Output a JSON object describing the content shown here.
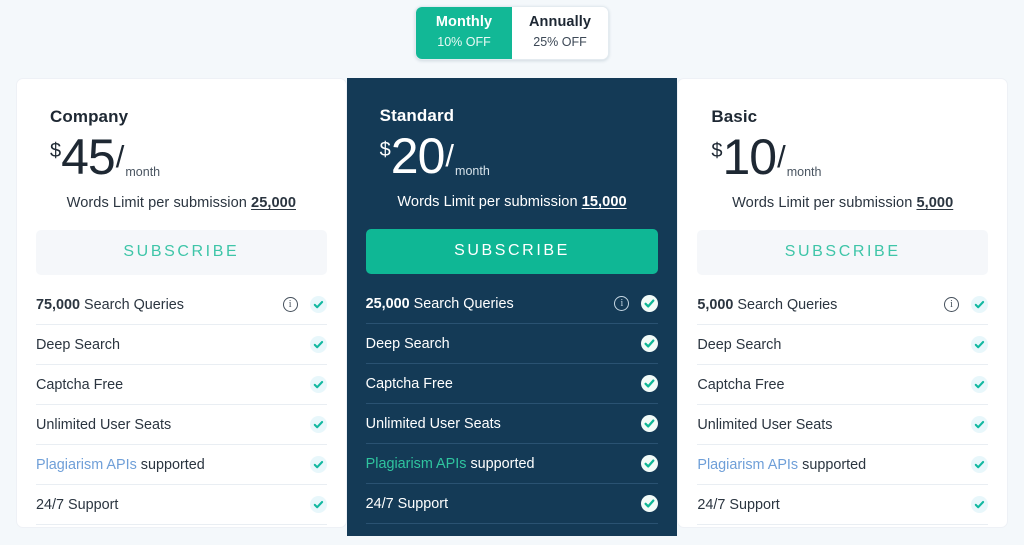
{
  "billing_toggle": {
    "options": [
      {
        "name": "Monthly",
        "discount": "10% OFF",
        "active": true
      },
      {
        "name": "Annually",
        "discount": "25% OFF",
        "active": false
      }
    ]
  },
  "colors": {
    "page_background": "#f4f8fb",
    "accent_teal": "#0fb795",
    "featured_card_background": "#143a56",
    "ghost_button_background": "#f5f7fa",
    "ghost_button_text": "#3ec5a8",
    "link_blue": "#6f9fd8",
    "link_teal": "#2fc49f"
  },
  "plans": [
    {
      "name": "Company",
      "currency": "$",
      "amount": "45",
      "slash": "/",
      "period": "month",
      "words_limit_label": "Words Limit per submission",
      "words_limit_value": "25,000",
      "subscribe_label": "SUBSCRIBE",
      "featured": false,
      "features": [
        {
          "strong": "75,000",
          "text": " Search Queries",
          "info": true,
          "info_icon": "info-icon",
          "check_icon": "check-icon",
          "link": ""
        },
        {
          "strong": "",
          "text": "Deep Search",
          "info": false,
          "info_icon": "",
          "check_icon": "check-icon",
          "link": ""
        },
        {
          "strong": "",
          "text": "Captcha Free",
          "info": false,
          "info_icon": "",
          "check_icon": "check-icon",
          "link": ""
        },
        {
          "strong": "",
          "text": "Unlimited User Seats",
          "info": false,
          "info_icon": "",
          "check_icon": "check-icon",
          "link": ""
        },
        {
          "strong": "",
          "text": " supported",
          "info": false,
          "info_icon": "",
          "check_icon": "check-icon",
          "link": "Plagiarism APIs"
        },
        {
          "strong": "",
          "text": "24/7 Support",
          "info": false,
          "info_icon": "",
          "check_icon": "check-icon",
          "link": ""
        }
      ]
    },
    {
      "name": "Standard",
      "currency": "$",
      "amount": "20",
      "slash": "/",
      "period": "month",
      "words_limit_label": "Words Limit per submission",
      "words_limit_value": "15,000",
      "subscribe_label": "SUBSCRIBE",
      "featured": true,
      "features": [
        {
          "strong": "25,000",
          "text": " Search Queries",
          "info": true,
          "info_icon": "info-icon",
          "check_icon": "check-icon",
          "link": ""
        },
        {
          "strong": "",
          "text": "Deep Search",
          "info": false,
          "info_icon": "",
          "check_icon": "check-icon",
          "link": ""
        },
        {
          "strong": "",
          "text": "Captcha Free",
          "info": false,
          "info_icon": "",
          "check_icon": "check-icon",
          "link": ""
        },
        {
          "strong": "",
          "text": "Unlimited User Seats",
          "info": false,
          "info_icon": "",
          "check_icon": "check-icon",
          "link": ""
        },
        {
          "strong": "",
          "text": " supported",
          "info": false,
          "info_icon": "",
          "check_icon": "check-icon",
          "link": "Plagiarism APIs"
        },
        {
          "strong": "",
          "text": "24/7 Support",
          "info": false,
          "info_icon": "",
          "check_icon": "check-icon",
          "link": ""
        }
      ]
    },
    {
      "name": "Basic",
      "currency": "$",
      "amount": "10",
      "slash": "/",
      "period": "month",
      "words_limit_label": "Words Limit per submission",
      "words_limit_value": "5,000",
      "subscribe_label": "SUBSCRIBE",
      "featured": false,
      "features": [
        {
          "strong": "5,000",
          "text": " Search Queries",
          "info": true,
          "info_icon": "info-icon",
          "check_icon": "check-icon",
          "link": ""
        },
        {
          "strong": "",
          "text": "Deep Search",
          "info": false,
          "info_icon": "",
          "check_icon": "check-icon",
          "link": ""
        },
        {
          "strong": "",
          "text": "Captcha Free",
          "info": false,
          "info_icon": "",
          "check_icon": "check-icon",
          "link": ""
        },
        {
          "strong": "",
          "text": "Unlimited User Seats",
          "info": false,
          "info_icon": "",
          "check_icon": "check-icon",
          "link": ""
        },
        {
          "strong": "",
          "text": " supported",
          "info": false,
          "info_icon": "",
          "check_icon": "check-icon",
          "link": "Plagiarism APIs"
        },
        {
          "strong": "",
          "text": "24/7 Support",
          "info": false,
          "info_icon": "",
          "check_icon": "check-icon",
          "link": ""
        }
      ]
    }
  ]
}
